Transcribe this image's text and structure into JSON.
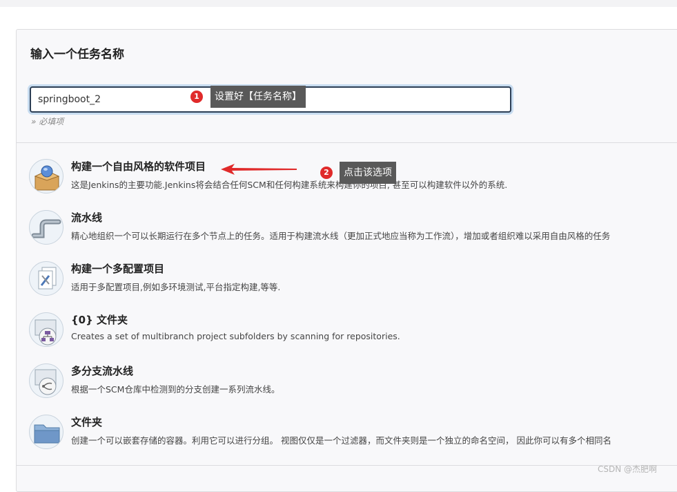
{
  "heading": "输入一个任务名称",
  "task_name": {
    "value": "springboot_2",
    "required_note": "» 必填项"
  },
  "annotations": [
    {
      "number": "1",
      "text": "设置好【任务名称】"
    },
    {
      "number": "2",
      "text": "点击该选项"
    }
  ],
  "items": [
    {
      "title": "构建一个自由风格的软件项目",
      "description": "这是Jenkins的主要功能.Jenkins将会结合任何SCM和任何构建系统来构建你的项目, 甚至可以构建软件以外的系统.",
      "icon": "freestyle-box-icon"
    },
    {
      "title": "流水线",
      "description": "精心地组织一个可以长期运行在多个节点上的任务。适用于构建流水线（更加正式地应当称为工作流），增加或者组织难以采用自由风格的任务",
      "icon": "pipeline-icon"
    },
    {
      "title": "构建一个多配置项目",
      "description": "适用于多配置项目,例如多环境测试,平台指定构建,等等.",
      "icon": "multi-config-icon"
    },
    {
      "title": "{0} 文件夹",
      "description": "Creates a set of multibranch project subfolders by scanning for repositories.",
      "icon": "org-folder-icon"
    },
    {
      "title": "多分支流水线",
      "description": "根据一个SCM仓库中检测到的分支创建一系列流水线。",
      "icon": "multibranch-icon"
    },
    {
      "title": "文件夹",
      "description": "创建一个可以嵌套存储的容器。利用它可以进行分组。 视图仅仅是一个过滤器，而文件夹则是一个独立的命名空间， 因此你可以有多个相同名",
      "icon": "folder-icon"
    }
  ],
  "watermark": "CSDN @杰肥啊",
  "colors": {
    "annotation_red": "#e02a2a",
    "tooltip_bg": "#595959",
    "input_border": "#2c3e55"
  }
}
